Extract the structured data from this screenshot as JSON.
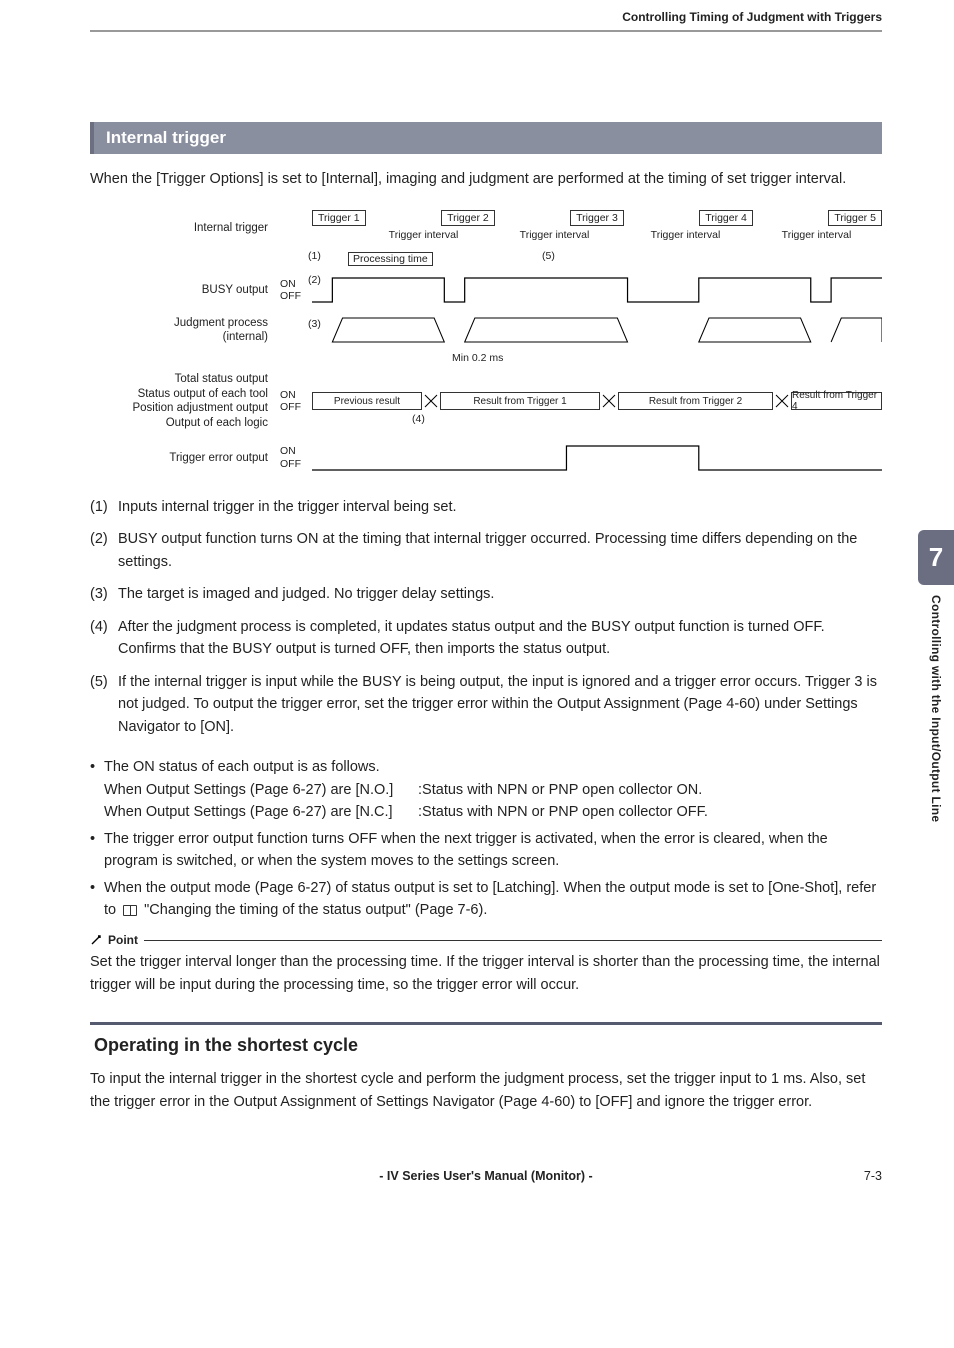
{
  "header": {
    "section": "Controlling Timing of Judgment with Triggers"
  },
  "sideTab": {
    "number": "7",
    "label": "Controlling with the Input/Output Line"
  },
  "section": {
    "title": "Internal trigger",
    "intro": "When the [Trigger Options] is set to [Internal], imaging and judgment are performed at the timing of set trigger interval."
  },
  "diagram": {
    "rows": {
      "internalTrigger": "Internal trigger",
      "busy": "BUSY output",
      "judgment": "Judgment process\n(internal)",
      "status": "Total status output\nStatus output of each tool\nPosition adjustment output\nOutput of each logic",
      "triggerError": "Trigger error output"
    },
    "on": "ON",
    "off": "OFF",
    "triggers": [
      "Trigger 1",
      "Trigger 2",
      "Trigger 3",
      "Trigger 4",
      "Trigger 5"
    ],
    "intervalLabel": "Trigger interval",
    "processingTime": "Processing time",
    "minTime": "Min 0.2 ms",
    "marks": {
      "m1": "(1)",
      "m2": "(2)",
      "m3": "(3)",
      "m4": "(4)",
      "m5": "(5)"
    },
    "statusCells": [
      "Previous result",
      "Result from Trigger 1",
      "Result from Trigger 2",
      "Result from Trigger 4"
    ]
  },
  "numbered": [
    {
      "n": "(1)",
      "t": "Inputs internal trigger in the trigger interval being set."
    },
    {
      "n": "(2)",
      "t": "BUSY output function turns ON at the timing that internal trigger occurred. Processing time differs depending on the settings."
    },
    {
      "n": "(3)",
      "t": "The target is imaged and judged. No trigger delay settings."
    },
    {
      "n": "(4)",
      "t": "After the judgment process is completed, it updates status output and the BUSY output function is turned OFF. Confirms that the BUSY output is turned OFF, then imports the status output."
    },
    {
      "n": "(5)",
      "t": "If the internal trigger is input while the BUSY is being output, the input is ignored and a trigger error occurs. Trigger 3 is not judged. To output the trigger error, set the trigger error within the Output Assignment (Page 4-60) under Settings Navigator to [ON]."
    }
  ],
  "bullets": {
    "b1a": "The ON status of each output is as follows.",
    "b1b": "When Output Settings (Page 6-27) are [N.O.]",
    "b1b_r": ":Status with NPN or PNP open collector ON.",
    "b1c": "When Output Settings (Page 6-27) are [N.C.]",
    "b1c_r": ":Status with NPN or PNP open collector OFF.",
    "b2": "The trigger error output function turns OFF when the next trigger is activated, when the error is cleared, when the program is switched, or when the system moves to the settings screen.",
    "b3a": "When the output mode (Page 6-27) of status output is set to [Latching]. When the output mode is set to [One-Shot], refer to ",
    "b3b": " \"Changing the timing of the status output\" (Page 7-6)."
  },
  "point": {
    "label": "Point",
    "text": "Set the trigger interval longer than the processing time. If the trigger interval is shorter than the processing time, the internal trigger will be input during the processing time, so the trigger error will occur."
  },
  "subsection": {
    "title": "Operating in the shortest cycle",
    "text": "To input the internal trigger in the shortest cycle and perform the judgment process, set the trigger input to 1 ms. Also, set the trigger error in the Output Assignment of Settings Navigator (Page 4-60) to [OFF] and ignore the trigger error."
  },
  "footer": {
    "center": "- IV Series User's Manual (Monitor) -",
    "right": "7-3"
  }
}
